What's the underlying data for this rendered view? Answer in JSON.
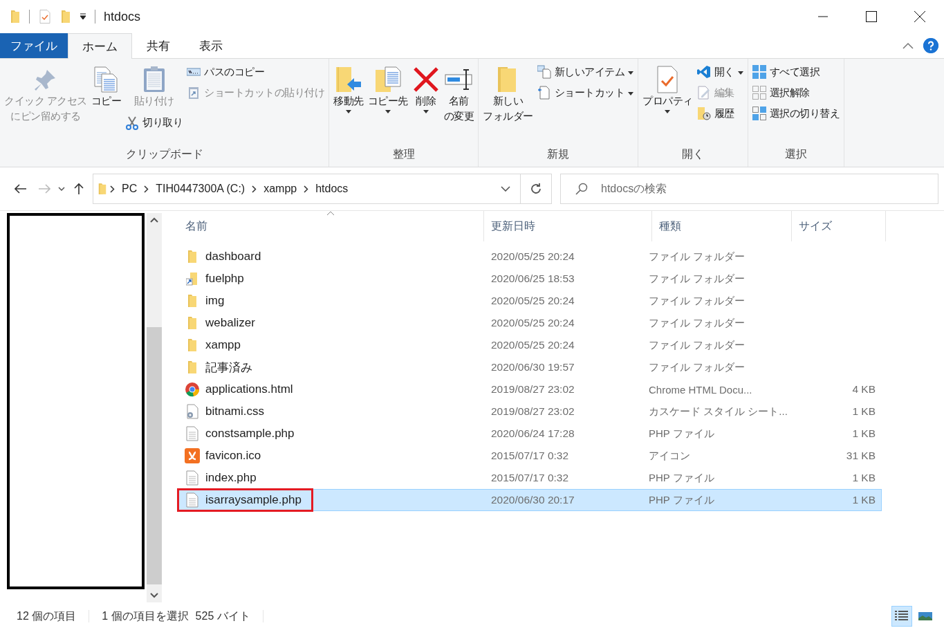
{
  "window": {
    "title": "htdocs"
  },
  "tabs": [
    {
      "label": "ファイル",
      "kind": "file",
      "selected": false
    },
    {
      "label": "ホーム",
      "kind": "tab",
      "selected": true
    },
    {
      "label": "共有",
      "kind": "tab",
      "selected": false
    },
    {
      "label": "表示",
      "kind": "tab",
      "selected": false
    }
  ],
  "ribbon": {
    "groups": [
      {
        "label": "クリップボード",
        "columns": [
          [
            {
              "kind": "large",
              "lines": [
                "クイック アクセス",
                "にピン留めする"
              ],
              "disabled": true,
              "dropdown": false
            }
          ],
          [
            {
              "kind": "large",
              "label": "コピー",
              "disabled": false,
              "dropdown": false
            }
          ],
          [
            {
              "kind": "large",
              "label": "貼り付け",
              "disabled": true,
              "dropdown": false
            },
            {
              "kind": "small",
              "label": "切り取り",
              "disabled": false,
              "dropdown": false
            }
          ],
          [
            {
              "kind": "small",
              "label": "パスのコピー",
              "disabled": false,
              "dropdown": false
            },
            {
              "kind": "small",
              "label": "ショートカットの貼り付け",
              "disabled": true,
              "dropdown": false
            }
          ]
        ]
      },
      {
        "label": "整理",
        "columns": [
          [
            {
              "kind": "large",
              "label": "移動先",
              "disabled": false,
              "dropdown": true
            }
          ],
          [
            {
              "kind": "large",
              "label": "コピー先",
              "disabled": false,
              "dropdown": true
            }
          ],
          [
            {
              "kind": "large",
              "label": "削除",
              "disabled": false,
              "dropdown": true
            }
          ],
          [
            {
              "kind": "large",
              "lines": [
                "名前",
                "の変更"
              ],
              "disabled": false,
              "dropdown": false
            }
          ]
        ]
      },
      {
        "label": "新規",
        "columns": [
          [
            {
              "kind": "large",
              "lines": [
                "新しい",
                "フォルダー"
              ],
              "disabled": false,
              "dropdown": false
            }
          ],
          [
            {
              "kind": "small",
              "label": "新しいアイテム",
              "disabled": false,
              "dropdown": true
            },
            {
              "kind": "small",
              "label": "ショートカット",
              "disabled": false,
              "dropdown": true
            }
          ]
        ]
      },
      {
        "label": "開く",
        "columns": [
          [
            {
              "kind": "large",
              "label": "プロパティ",
              "disabled": false,
              "dropdown": true
            }
          ],
          [
            {
              "kind": "small",
              "label": "開く",
              "disabled": false,
              "dropdown": true
            },
            {
              "kind": "small",
              "label": "編集",
              "disabled": true,
              "dropdown": false
            },
            {
              "kind": "small",
              "label": "履歴",
              "disabled": false,
              "dropdown": false
            }
          ]
        ]
      },
      {
        "label": "選択",
        "columns": [
          [
            {
              "kind": "small",
              "label": "すべて選択",
              "disabled": false,
              "dropdown": false
            },
            {
              "kind": "small",
              "label": "選択解除",
              "disabled": false,
              "dropdown": false
            },
            {
              "kind": "small",
              "label": "選択の切り替え",
              "disabled": false,
              "dropdown": false
            }
          ]
        ]
      }
    ]
  },
  "address": {
    "crumbs": [
      "PC",
      "TIH0447300A (C:)",
      "xampp",
      "htdocs"
    ]
  },
  "search": {
    "placeholder": "htdocsの検索"
  },
  "columns": [
    "名前",
    "更新日時",
    "種類",
    "サイズ"
  ],
  "files": [
    {
      "kind": "folder",
      "name": "dashboard",
      "modified": "2020/05/25 20:24",
      "type": "ファイル フォルダー",
      "selected": false,
      "annotated": false
    },
    {
      "kind": "shortcut-folder",
      "name": "fuelphp",
      "modified": "2020/06/25 18:53",
      "type": "ファイル フォルダー",
      "selected": false,
      "annotated": false
    },
    {
      "kind": "folder",
      "name": "img",
      "modified": "2020/05/25 20:24",
      "type": "ファイル フォルダー",
      "selected": false,
      "annotated": false
    },
    {
      "kind": "folder",
      "name": "webalizer",
      "modified": "2020/05/25 20:24",
      "type": "ファイル フォルダー",
      "selected": false,
      "annotated": false
    },
    {
      "kind": "folder",
      "name": "xampp",
      "modified": "2020/05/25 20:24",
      "type": "ファイル フォルダー",
      "selected": false,
      "annotated": false
    },
    {
      "kind": "folder",
      "name": "記事済み",
      "modified": "2020/06/30 19:57",
      "type": "ファイル フォルダー",
      "selected": false,
      "annotated": false
    },
    {
      "kind": "chrome",
      "name": "applications.html",
      "modified": "2019/08/27 23:02",
      "type": "Chrome HTML Docu...",
      "size": "4 KB",
      "selected": false,
      "annotated": false
    },
    {
      "kind": "css",
      "name": "bitnami.css",
      "modified": "2019/08/27 23:02",
      "type": "カスケード スタイル シート...",
      "size": "1 KB",
      "selected": false,
      "annotated": false
    },
    {
      "kind": "text",
      "name": "constsample.php",
      "modified": "2020/06/24 17:28",
      "type": "PHP ファイル",
      "size": "1 KB",
      "selected": false,
      "annotated": false
    },
    {
      "kind": "xampp",
      "name": "favicon.ico",
      "modified": "2015/07/17 0:32",
      "type": "アイコン",
      "size": "31 KB",
      "selected": false,
      "annotated": false
    },
    {
      "kind": "text",
      "name": "index.php",
      "modified": "2015/07/17 0:32",
      "type": "PHP ファイル",
      "size": "1 KB",
      "selected": false,
      "annotated": false
    },
    {
      "kind": "text",
      "name": "isarraysample.php",
      "modified": "2020/06/30 20:17",
      "type": "PHP ファイル",
      "size": "1 KB",
      "selected": true,
      "annotated": true
    }
  ],
  "status_bar": {
    "count": "12 個の項目",
    "selection": "1 個の項目を選択",
    "bytes": "525 バイト"
  },
  "views": [
    {
      "kind": "details",
      "selected": true
    },
    {
      "kind": "large-icons",
      "selected": false
    }
  ]
}
